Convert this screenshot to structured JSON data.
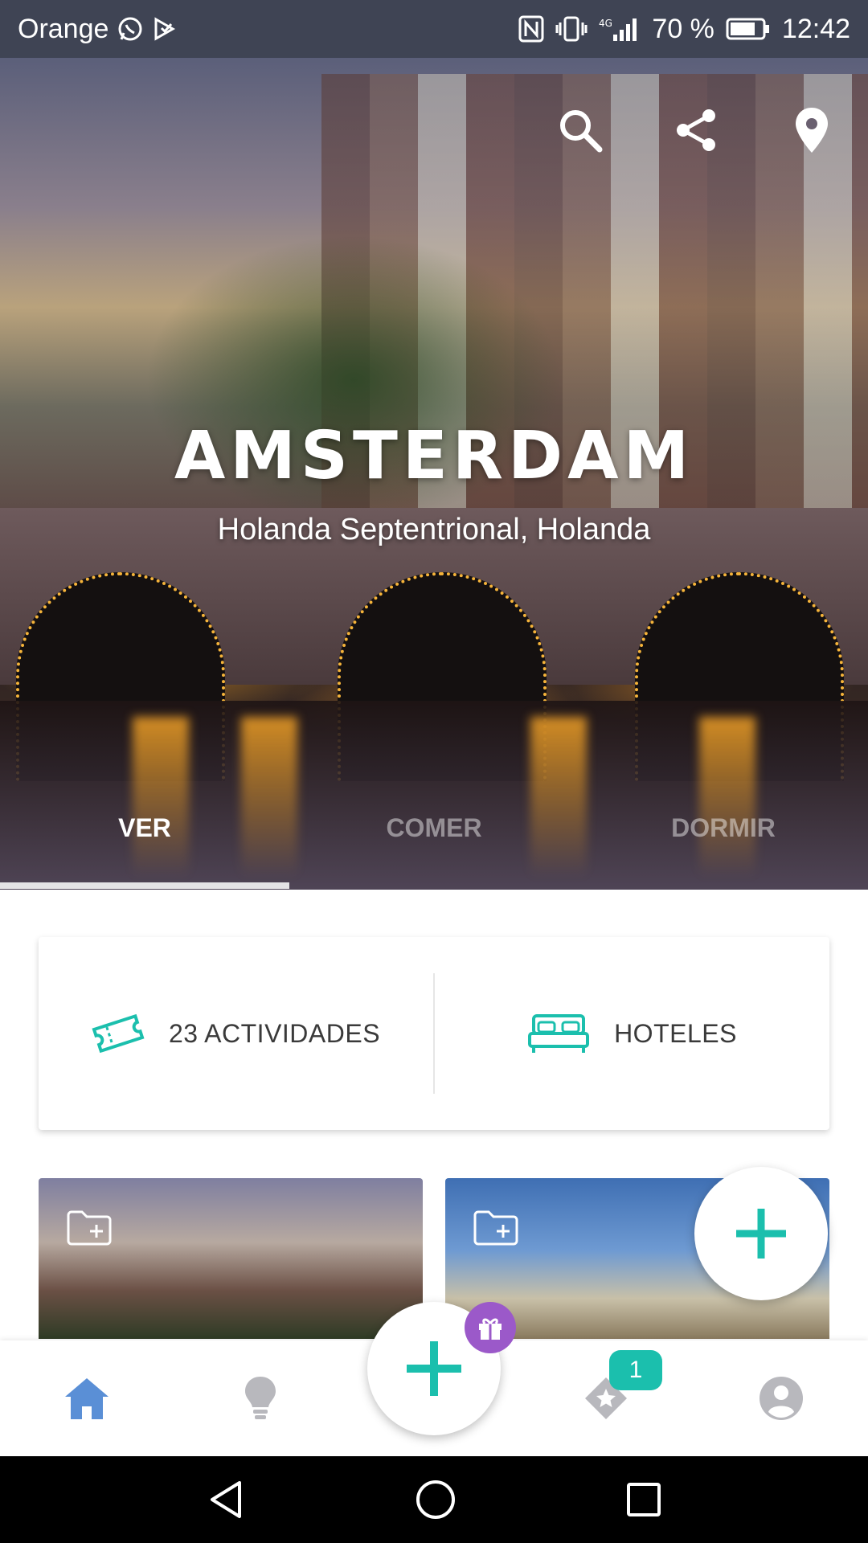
{
  "status_bar": {
    "carrier": "Orange",
    "network": "4G",
    "battery": "70 %",
    "time": "12:42"
  },
  "hero": {
    "title": "AMSTERDAM",
    "subtitle": "Holanda Septentrional, Holanda",
    "actions": [
      "search-icon",
      "share-icon",
      "location-pin-icon"
    ]
  },
  "tabs": [
    {
      "label": "VER",
      "active": true
    },
    {
      "label": "COMER",
      "active": false
    },
    {
      "label": "DORMIR",
      "active": false
    }
  ],
  "info_card": {
    "activities_label": "23 ACTIVIDADES",
    "hotels_label": "HOTELES"
  },
  "photos": [
    {
      "icon": "folder-add-icon"
    },
    {
      "icon": "folder-add-icon"
    }
  ],
  "bottom_nav": {
    "items": [
      "home-icon",
      "lightbulb-icon",
      "add-icon",
      "star-tag-icon",
      "profile-icon"
    ],
    "favorites_badge": "1"
  },
  "colors": {
    "accent": "#1bbfad",
    "gift": "#9b59c9",
    "nav_active": "#5a8fd6",
    "nav_inactive": "#b8b8bd",
    "status_bar": "#3f4454"
  }
}
